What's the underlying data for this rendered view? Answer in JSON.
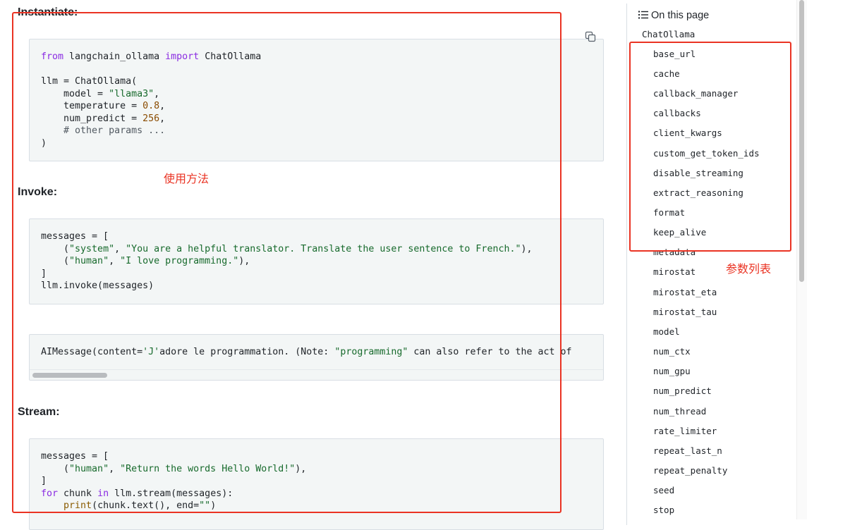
{
  "headings": {
    "instantiate": "Instantiate:",
    "invoke": "Invoke:",
    "stream": "Stream:"
  },
  "code_instantiate": {
    "l1_kw1": "from",
    "l1_mod": " langchain_ollama ",
    "l1_kw2": "import",
    "l1_name": " ChatOllama",
    "l3": "llm = ChatOllama(",
    "l4_pre": "    model = ",
    "l4_str": "\"llama3\"",
    "l4_post": ",",
    "l5_pre": "    temperature = ",
    "l5_num": "0.8",
    "l5_post": ",",
    "l6_pre": "    num_predict = ",
    "l6_num": "256",
    "l6_post": ",",
    "l7_cmt": "    # other params ...",
    "l8": ")"
  },
  "code_invoke": {
    "l1": "messages = [",
    "l2_pre": "    (",
    "l2_s1": "\"system\"",
    "l2_mid": ", ",
    "l2_s2": "\"You are a helpful translator. Translate the user sentence to French.\"",
    "l2_post": "),",
    "l3_pre": "    (",
    "l3_s1": "\"human\"",
    "l3_mid": ", ",
    "l3_s2": "\"I love programming.\"",
    "l3_post": "),",
    "l4": "]",
    "l5": "llm.invoke(messages)"
  },
  "code_output": {
    "pre": "AIMessage(content=",
    "s1": "'J'",
    "mid": "adore le programmation. (Note: ",
    "s2": "\"programming\"",
    "post": " can also refer to the act of"
  },
  "code_stream": {
    "l1": "messages = [",
    "l2_pre": "    (",
    "l2_s1": "\"human\"",
    "l2_mid": ", ",
    "l2_s2": "\"Return the words Hello World!\"",
    "l2_post": "),",
    "l3": "]",
    "l4_kw1": "for",
    "l4_mid": " chunk ",
    "l4_kw2": "in",
    "l4_post": " llm.stream(messages):",
    "l5_pre": "    ",
    "l5_fn": "print",
    "l5_mid": "(chunk.text(), end=",
    "l5_str": "\"\"",
    "l5_post": ")"
  },
  "icons": {
    "copy": "copy-icon",
    "list": "list-icon"
  },
  "annotations": {
    "usage_label": "使用方法",
    "params_label": "参数列表",
    "color": "#ea3323"
  },
  "toc": {
    "title": "On this page",
    "root": "ChatOllama",
    "items": [
      "base_url",
      "cache",
      "callback_manager",
      "callbacks",
      "client_kwargs",
      "custom_get_token_ids",
      "disable_streaming",
      "extract_reasoning",
      "format",
      "keep_alive",
      "metadata",
      "mirostat",
      "mirostat_eta",
      "mirostat_tau",
      "model",
      "num_ctx",
      "num_gpu",
      "num_predict",
      "num_thread",
      "rate_limiter",
      "repeat_last_n",
      "repeat_penalty",
      "seed",
      "stop"
    ]
  }
}
